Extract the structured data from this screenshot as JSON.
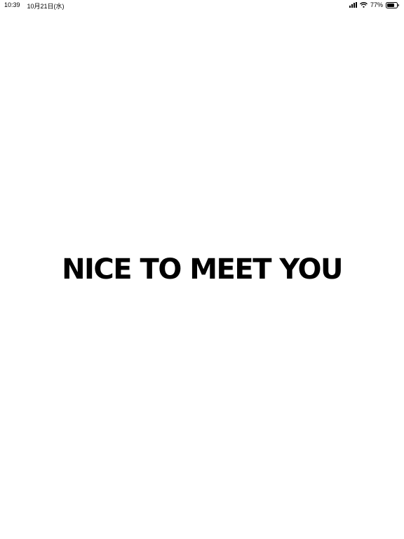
{
  "status_bar": {
    "time": "10:39",
    "date": "10月21日(水)",
    "battery_percent": "77%",
    "battery_level": 0.77,
    "icons": [
      "signal-icon",
      "wifi-icon",
      "battery-icon"
    ]
  },
  "main": {
    "text": "NICE TO MEET YOU"
  },
  "colors": {
    "background": "#ffffff",
    "text": "#000000"
  }
}
